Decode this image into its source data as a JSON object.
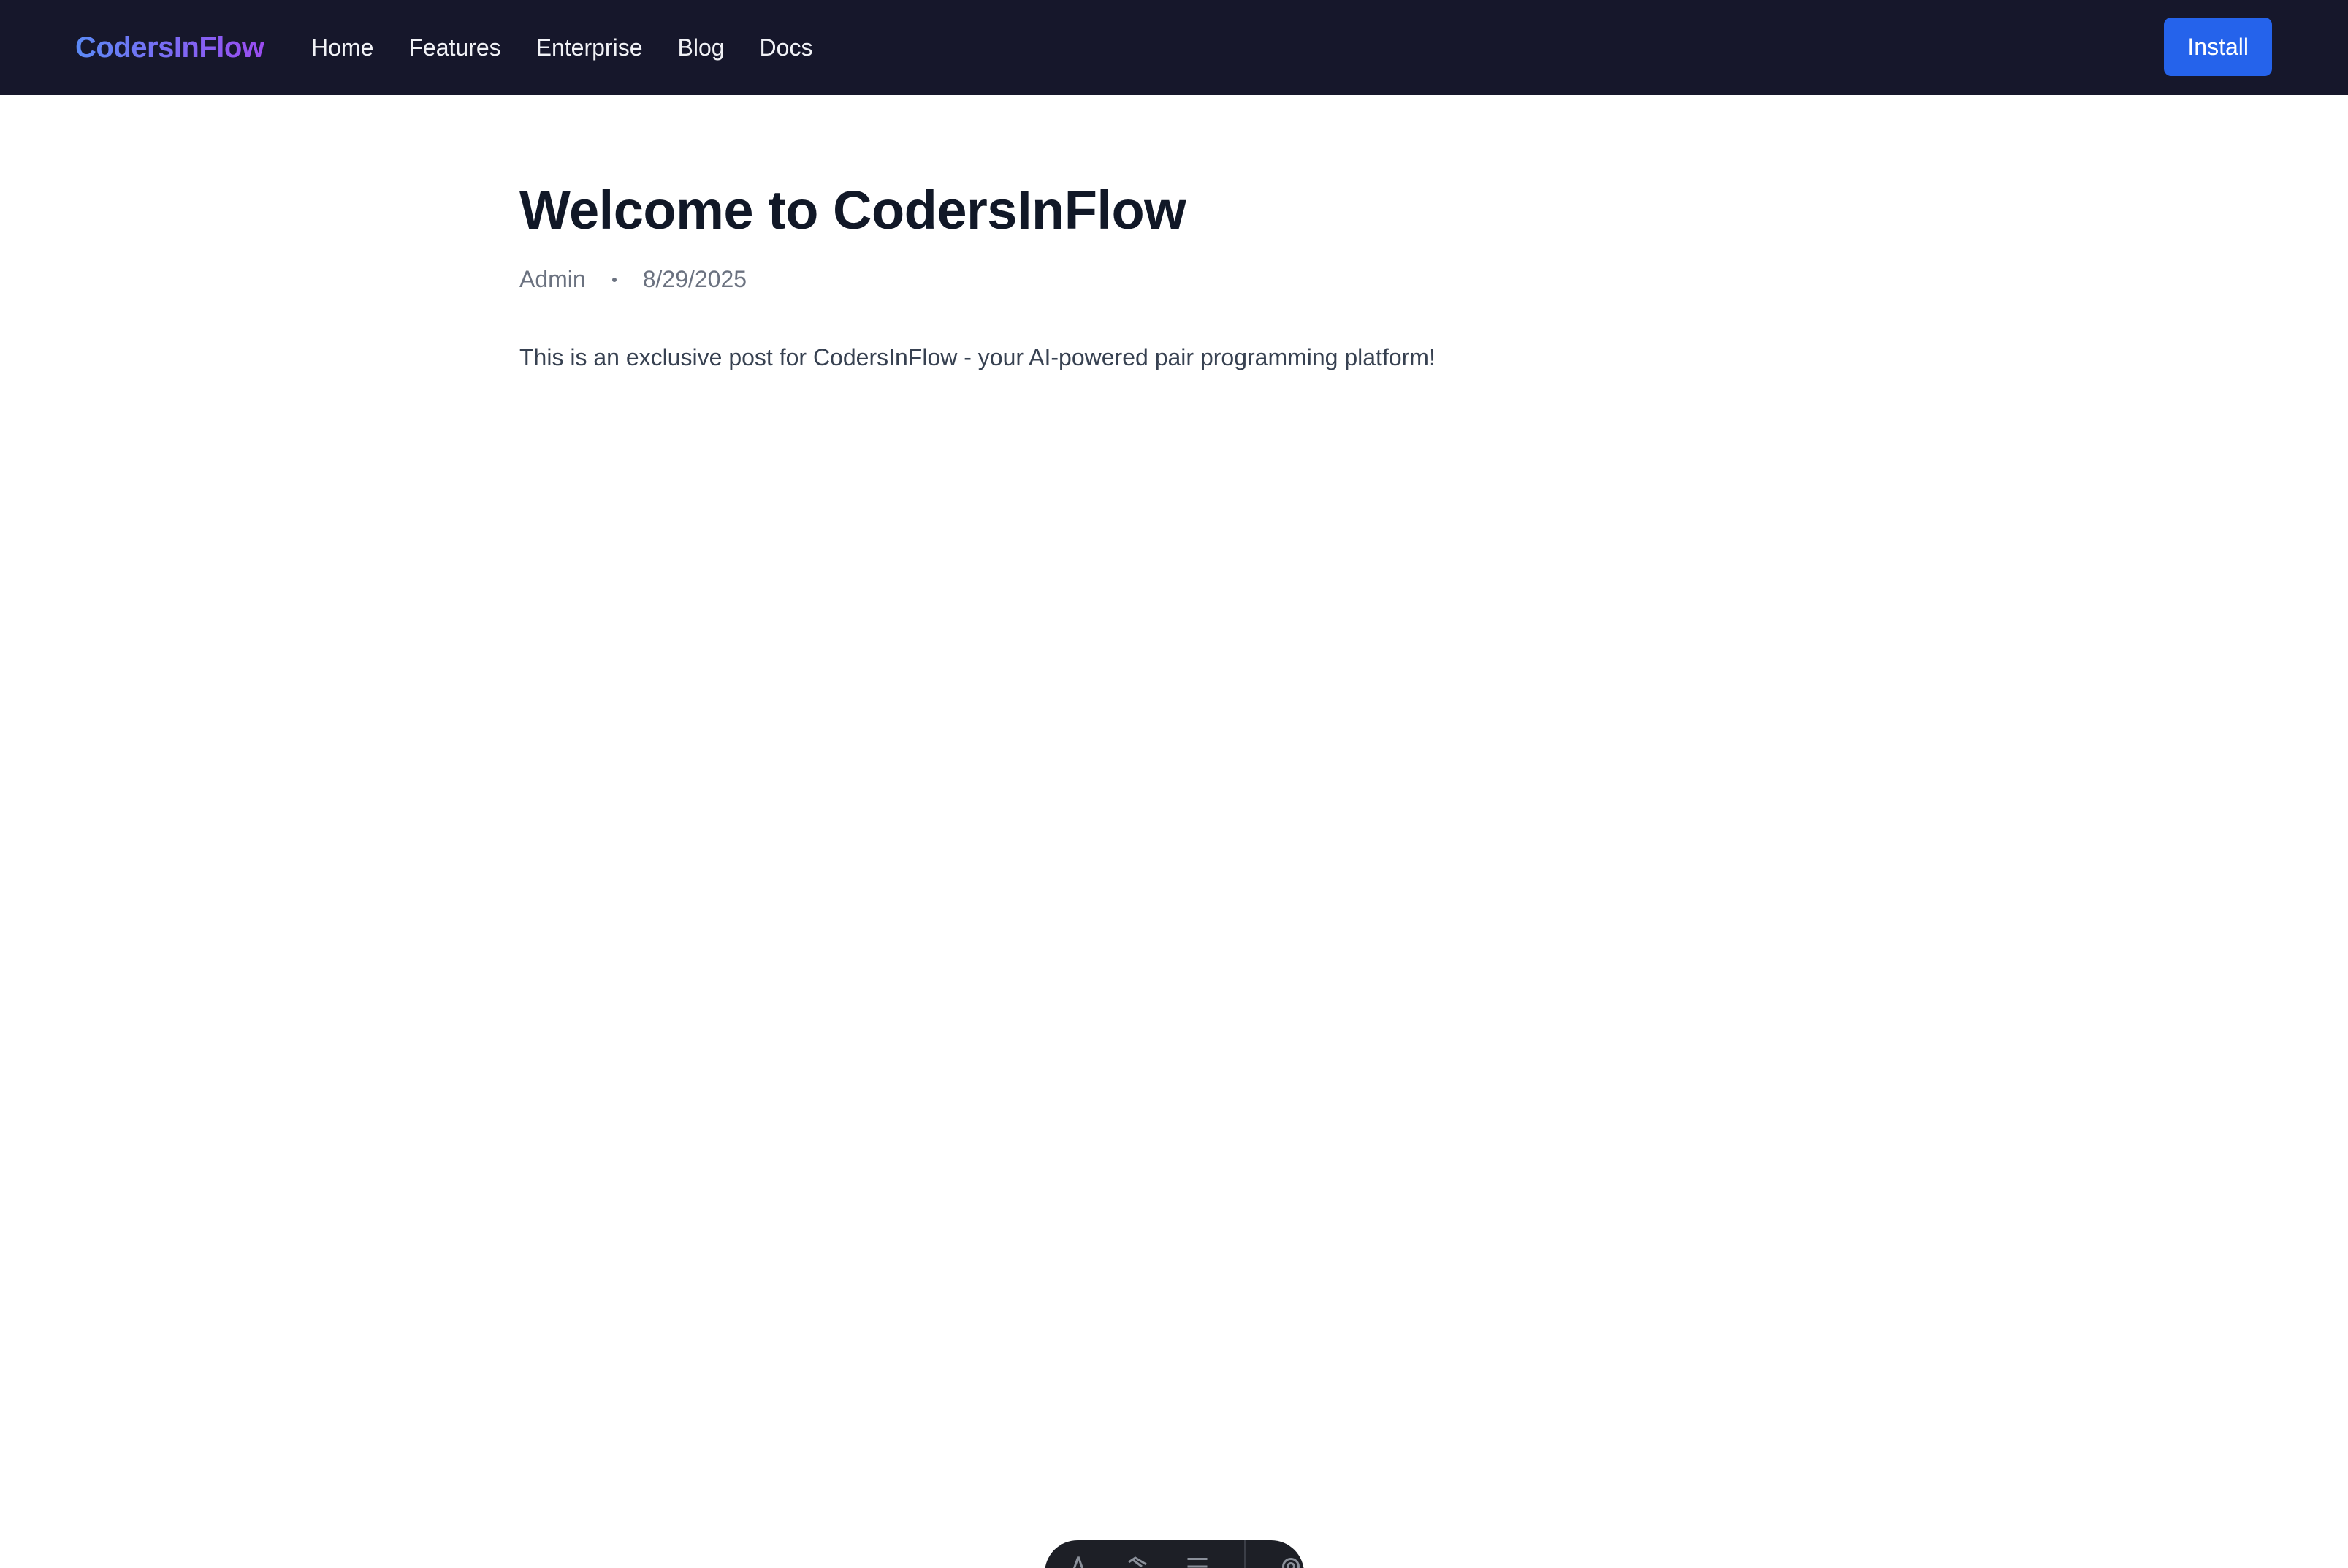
{
  "navbar": {
    "brand": "CodersInFlow",
    "links": [
      "Home",
      "Features",
      "Enterprise",
      "Blog",
      "Docs"
    ],
    "install_label": "Install",
    "colors": {
      "background": "#16172b",
      "brand_gradient_start": "#5b8af6",
      "brand_gradient_end": "#9a4cf0",
      "install_button": "#2563eb"
    }
  },
  "post": {
    "title": "Welcome to CodersInFlow",
    "author": "Admin",
    "date": "8/29/2025",
    "body": "This is an exclusive post for CodersInFlow - your AI-powered pair programming platform!"
  },
  "toolbar": {
    "icons": [
      "inspect-icon",
      "clap-icon",
      "menu-icon",
      "settings-icon"
    ]
  }
}
